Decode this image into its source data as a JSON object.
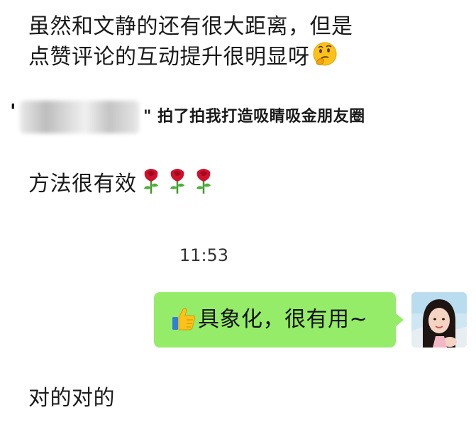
{
  "messages": {
    "incoming_1": {
      "line1": "虽然和文静的还有很大距离，但是",
      "line2": "点赞评论的互动提升很明显呀",
      "emoji": "thinking-face"
    },
    "quote": {
      "open_mark": "'",
      "text": "\" 拍了拍我打造吸睛吸金朋友圈"
    },
    "incoming_2": {
      "text": "方法很有效",
      "emoji": [
        "rose",
        "rose",
        "rose"
      ]
    },
    "timestamp": "11:53",
    "outgoing_1": {
      "emoji": "thumbs-up",
      "text": "具象化，很有用~"
    },
    "incoming_3": {
      "text": "对的对的"
    }
  },
  "colors": {
    "outgoing_bubble": "#95ec69",
    "background": "#ffffff",
    "text": "#1a1a1a"
  }
}
